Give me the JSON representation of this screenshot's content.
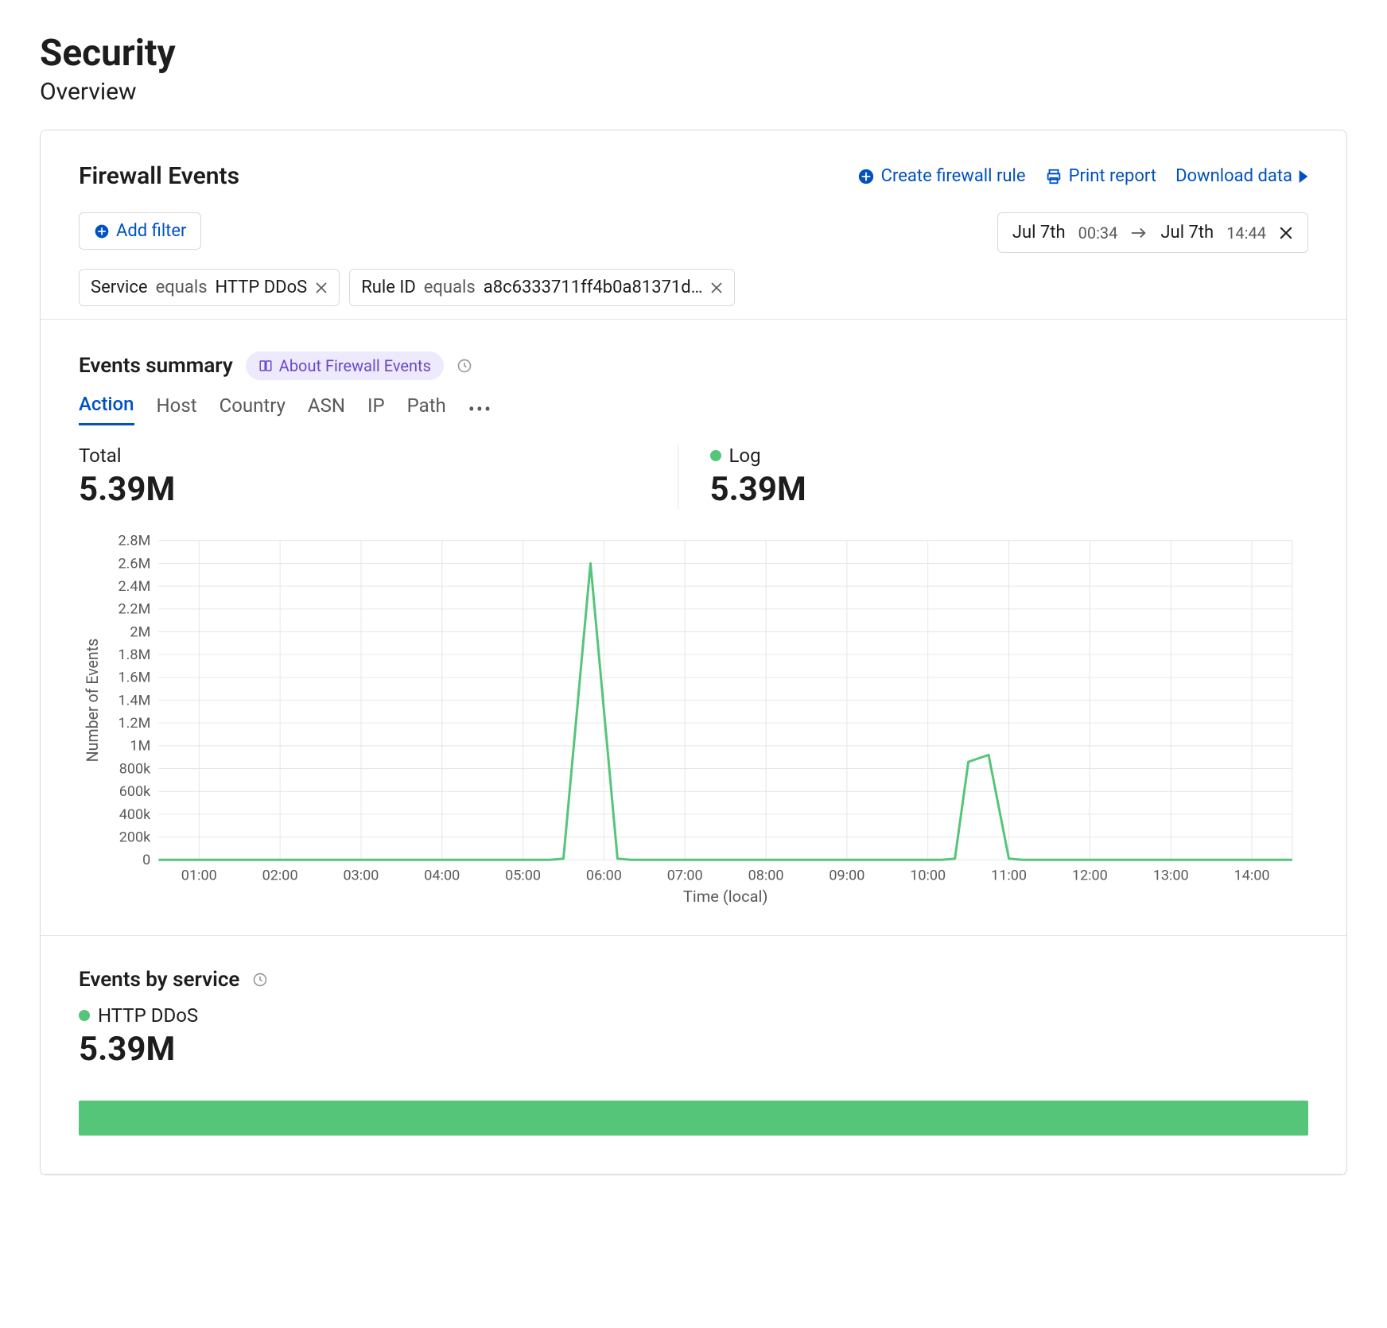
{
  "page_title": "Security",
  "page_subtitle": "Overview",
  "card": {
    "title": "Firewall Events",
    "actions": {
      "create_rule": "Create firewall rule",
      "print_report": "Print report",
      "download_data": "Download data"
    },
    "add_filter": "Add filter",
    "filters": [
      {
        "field": "Service",
        "operator": "equals",
        "value": "HTTP DDoS"
      },
      {
        "field": "Rule ID",
        "operator": "equals",
        "value": "a8c6333711ff4b0a81371d…"
      }
    ],
    "date_range": {
      "from_day": "Jul 7th",
      "from_time": "00:34",
      "to_day": "Jul 7th",
      "to_time": "14:44"
    }
  },
  "events_summary": {
    "title": "Events summary",
    "about_label": "About Firewall Events",
    "tabs": [
      "Action",
      "Host",
      "Country",
      "ASN",
      "IP",
      "Path"
    ],
    "active_tab": 0,
    "total_label": "Total",
    "total_value": "5.39M",
    "log_label": "Log",
    "log_value": "5.39M",
    "log_color": "#55c57a"
  },
  "events_by_service": {
    "title": "Events by service",
    "series_label": "HTTP DDoS",
    "series_value": "5.39M",
    "series_color": "#55c57a",
    "series_pct": 100
  },
  "chart_data": {
    "type": "line",
    "title": "",
    "xlabel": "Time (local)",
    "ylabel": "Number of Events",
    "x_ticks": [
      "01:00",
      "02:00",
      "03:00",
      "04:00",
      "05:00",
      "06:00",
      "07:00",
      "08:00",
      "09:00",
      "10:00",
      "11:00",
      "12:00",
      "13:00",
      "14:00"
    ],
    "y_ticks": [
      0,
      200000,
      400000,
      600000,
      800000,
      1000000,
      1200000,
      1400000,
      1600000,
      1800000,
      2000000,
      2200000,
      2400000,
      2600000,
      2800000
    ],
    "y_tick_labels": [
      "0",
      "200k",
      "400k",
      "600k",
      "800k",
      "1M",
      "1.2M",
      "1.4M",
      "1.6M",
      "1.8M",
      "2M",
      "2.2M",
      "2.4M",
      "2.6M",
      "2.8M"
    ],
    "ylim": [
      0,
      2800000
    ],
    "xlim_minutes": [
      30,
      870
    ],
    "series": [
      {
        "name": "Log",
        "color": "#55c57a",
        "points": [
          {
            "x_minutes": 30,
            "y": 0
          },
          {
            "x_minutes": 320,
            "y": 0
          },
          {
            "x_minutes": 330,
            "y": 10000
          },
          {
            "x_minutes": 350,
            "y": 2600000
          },
          {
            "x_minutes": 370,
            "y": 10000
          },
          {
            "x_minutes": 380,
            "y": 0
          },
          {
            "x_minutes": 610,
            "y": 0
          },
          {
            "x_minutes": 620,
            "y": 10000
          },
          {
            "x_minutes": 630,
            "y": 860000
          },
          {
            "x_minutes": 645,
            "y": 920000
          },
          {
            "x_minutes": 660,
            "y": 10000
          },
          {
            "x_minutes": 670,
            "y": 0
          },
          {
            "x_minutes": 870,
            "y": 0
          }
        ]
      }
    ]
  }
}
